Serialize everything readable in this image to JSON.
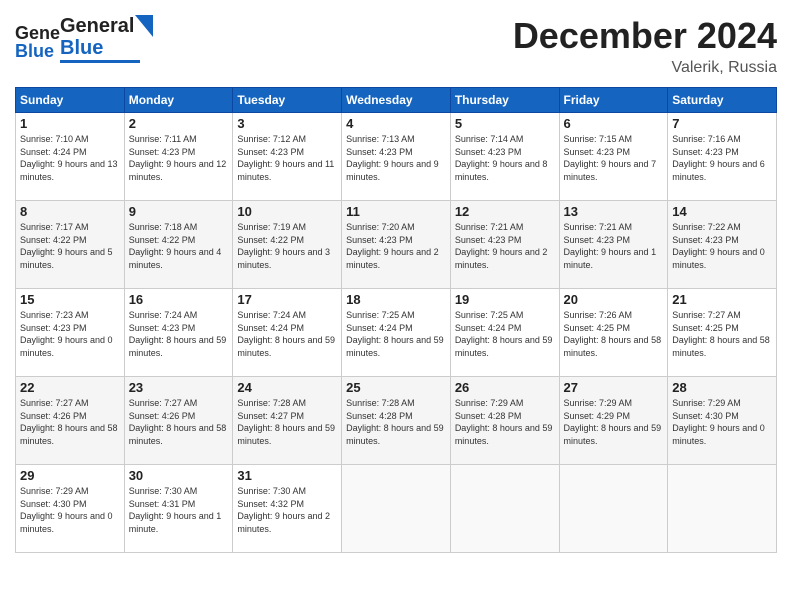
{
  "header": {
    "logo_general": "General",
    "logo_blue": "Blue",
    "month": "December 2024",
    "location": "Valerik, Russia"
  },
  "days_of_week": [
    "Sunday",
    "Monday",
    "Tuesday",
    "Wednesday",
    "Thursday",
    "Friday",
    "Saturday"
  ],
  "weeks": [
    [
      {
        "day": "1",
        "sunrise": "Sunrise: 7:10 AM",
        "sunset": "Sunset: 4:24 PM",
        "daylight": "Daylight: 9 hours and 13 minutes."
      },
      {
        "day": "2",
        "sunrise": "Sunrise: 7:11 AM",
        "sunset": "Sunset: 4:23 PM",
        "daylight": "Daylight: 9 hours and 12 minutes."
      },
      {
        "day": "3",
        "sunrise": "Sunrise: 7:12 AM",
        "sunset": "Sunset: 4:23 PM",
        "daylight": "Daylight: 9 hours and 11 minutes."
      },
      {
        "day": "4",
        "sunrise": "Sunrise: 7:13 AM",
        "sunset": "Sunset: 4:23 PM",
        "daylight": "Daylight: 9 hours and 9 minutes."
      },
      {
        "day": "5",
        "sunrise": "Sunrise: 7:14 AM",
        "sunset": "Sunset: 4:23 PM",
        "daylight": "Daylight: 9 hours and 8 minutes."
      },
      {
        "day": "6",
        "sunrise": "Sunrise: 7:15 AM",
        "sunset": "Sunset: 4:23 PM",
        "daylight": "Daylight: 9 hours and 7 minutes."
      },
      {
        "day": "7",
        "sunrise": "Sunrise: 7:16 AM",
        "sunset": "Sunset: 4:23 PM",
        "daylight": "Daylight: 9 hours and 6 minutes."
      }
    ],
    [
      {
        "day": "8",
        "sunrise": "Sunrise: 7:17 AM",
        "sunset": "Sunset: 4:22 PM",
        "daylight": "Daylight: 9 hours and 5 minutes."
      },
      {
        "day": "9",
        "sunrise": "Sunrise: 7:18 AM",
        "sunset": "Sunset: 4:22 PM",
        "daylight": "Daylight: 9 hours and 4 minutes."
      },
      {
        "day": "10",
        "sunrise": "Sunrise: 7:19 AM",
        "sunset": "Sunset: 4:22 PM",
        "daylight": "Daylight: 9 hours and 3 minutes."
      },
      {
        "day": "11",
        "sunrise": "Sunrise: 7:20 AM",
        "sunset": "Sunset: 4:23 PM",
        "daylight": "Daylight: 9 hours and 2 minutes."
      },
      {
        "day": "12",
        "sunrise": "Sunrise: 7:21 AM",
        "sunset": "Sunset: 4:23 PM",
        "daylight": "Daylight: 9 hours and 2 minutes."
      },
      {
        "day": "13",
        "sunrise": "Sunrise: 7:21 AM",
        "sunset": "Sunset: 4:23 PM",
        "daylight": "Daylight: 9 hours and 1 minute."
      },
      {
        "day": "14",
        "sunrise": "Sunrise: 7:22 AM",
        "sunset": "Sunset: 4:23 PM",
        "daylight": "Daylight: 9 hours and 0 minutes."
      }
    ],
    [
      {
        "day": "15",
        "sunrise": "Sunrise: 7:23 AM",
        "sunset": "Sunset: 4:23 PM",
        "daylight": "Daylight: 9 hours and 0 minutes."
      },
      {
        "day": "16",
        "sunrise": "Sunrise: 7:24 AM",
        "sunset": "Sunset: 4:23 PM",
        "daylight": "Daylight: 8 hours and 59 minutes."
      },
      {
        "day": "17",
        "sunrise": "Sunrise: 7:24 AM",
        "sunset": "Sunset: 4:24 PM",
        "daylight": "Daylight: 8 hours and 59 minutes."
      },
      {
        "day": "18",
        "sunrise": "Sunrise: 7:25 AM",
        "sunset": "Sunset: 4:24 PM",
        "daylight": "Daylight: 8 hours and 59 minutes."
      },
      {
        "day": "19",
        "sunrise": "Sunrise: 7:25 AM",
        "sunset": "Sunset: 4:24 PM",
        "daylight": "Daylight: 8 hours and 59 minutes."
      },
      {
        "day": "20",
        "sunrise": "Sunrise: 7:26 AM",
        "sunset": "Sunset: 4:25 PM",
        "daylight": "Daylight: 8 hours and 58 minutes."
      },
      {
        "day": "21",
        "sunrise": "Sunrise: 7:27 AM",
        "sunset": "Sunset: 4:25 PM",
        "daylight": "Daylight: 8 hours and 58 minutes."
      }
    ],
    [
      {
        "day": "22",
        "sunrise": "Sunrise: 7:27 AM",
        "sunset": "Sunset: 4:26 PM",
        "daylight": "Daylight: 8 hours and 58 minutes."
      },
      {
        "day": "23",
        "sunrise": "Sunrise: 7:27 AM",
        "sunset": "Sunset: 4:26 PM",
        "daylight": "Daylight: 8 hours and 58 minutes."
      },
      {
        "day": "24",
        "sunrise": "Sunrise: 7:28 AM",
        "sunset": "Sunset: 4:27 PM",
        "daylight": "Daylight: 8 hours and 59 minutes."
      },
      {
        "day": "25",
        "sunrise": "Sunrise: 7:28 AM",
        "sunset": "Sunset: 4:28 PM",
        "daylight": "Daylight: 8 hours and 59 minutes."
      },
      {
        "day": "26",
        "sunrise": "Sunrise: 7:29 AM",
        "sunset": "Sunset: 4:28 PM",
        "daylight": "Daylight: 8 hours and 59 minutes."
      },
      {
        "day": "27",
        "sunrise": "Sunrise: 7:29 AM",
        "sunset": "Sunset: 4:29 PM",
        "daylight": "Daylight: 8 hours and 59 minutes."
      },
      {
        "day": "28",
        "sunrise": "Sunrise: 7:29 AM",
        "sunset": "Sunset: 4:30 PM",
        "daylight": "Daylight: 9 hours and 0 minutes."
      }
    ],
    [
      {
        "day": "29",
        "sunrise": "Sunrise: 7:29 AM",
        "sunset": "Sunset: 4:30 PM",
        "daylight": "Daylight: 9 hours and 0 minutes."
      },
      {
        "day": "30",
        "sunrise": "Sunrise: 7:30 AM",
        "sunset": "Sunset: 4:31 PM",
        "daylight": "Daylight: 9 hours and 1 minute."
      },
      {
        "day": "31",
        "sunrise": "Sunrise: 7:30 AM",
        "sunset": "Sunset: 4:32 PM",
        "daylight": "Daylight: 9 hours and 2 minutes."
      },
      null,
      null,
      null,
      null
    ]
  ]
}
